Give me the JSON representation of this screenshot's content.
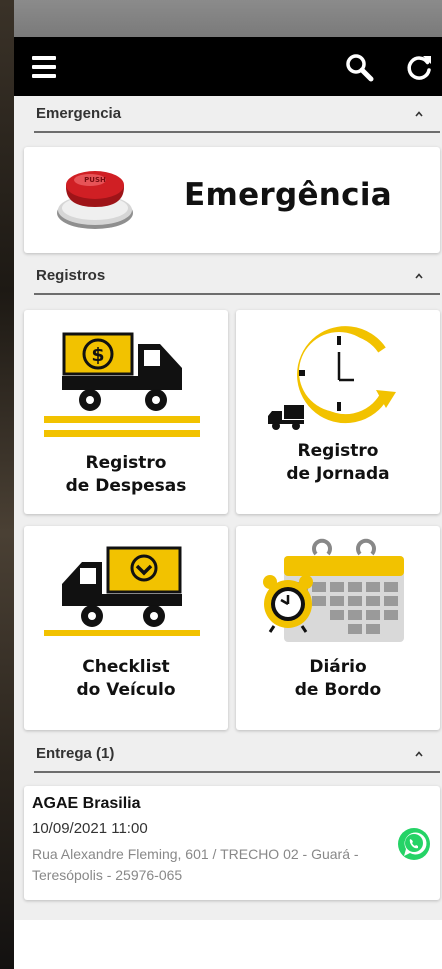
{
  "sections": {
    "emergencia": {
      "title": "Emergencia"
    },
    "registros": {
      "title": "Registros"
    },
    "entrega": {
      "title": "Entrega (1)"
    }
  },
  "emergency": {
    "label": "Emergência",
    "button_text": "PUSH"
  },
  "tiles": [
    {
      "line1": "Registro",
      "line2": "de Despesas"
    },
    {
      "line1": "Registro",
      "line2": "de Jornada"
    },
    {
      "line1": "Checklist",
      "line2": "do Veículo"
    },
    {
      "line1": "Diário",
      "line2": "de Bordo"
    }
  ],
  "delivery": {
    "name": "AGAE Brasilia",
    "datetime": "10/09/2021 11:00",
    "address": "Rua Alexandre Fleming, 601 / TRECHO 02 - Guará - Teresópolis - 25976-065"
  },
  "colors": {
    "accent_yellow": "#f2c200",
    "whatsapp_green": "#25d366",
    "appbar": "#000000",
    "emergency_red": "#d01f24"
  },
  "icons": {
    "menu": "hamburger-menu-icon",
    "search": "search-icon",
    "refresh": "refresh-icon",
    "whatsapp": "whatsapp-icon"
  }
}
